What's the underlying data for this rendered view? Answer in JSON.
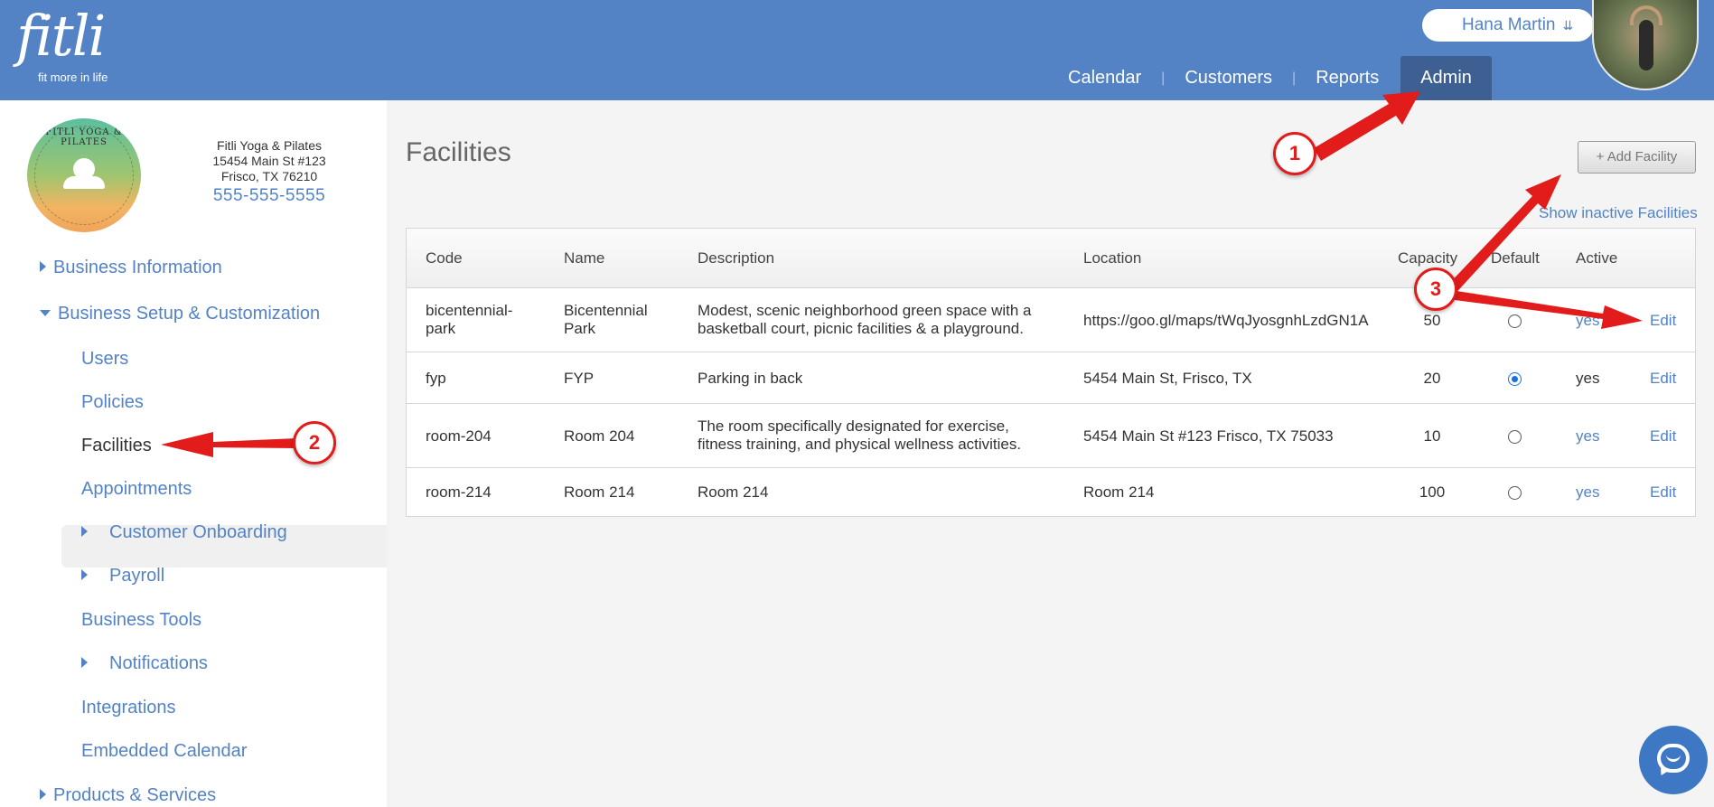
{
  "header": {
    "logo_word": "fitli",
    "logo_tagline": "fit more in life",
    "user_name": "Hana Martin",
    "nav": [
      {
        "label": "Calendar"
      },
      {
        "label": "Customers"
      },
      {
        "label": "Reports"
      },
      {
        "label": "Admin",
        "active": true
      }
    ]
  },
  "business": {
    "logo_text": "FITLI YOGA & PILATES",
    "name": "Fitli Yoga & Pilates",
    "address1": "15454 Main St #123",
    "address2": "Frisco, TX 76210",
    "phone": "555-555-5555"
  },
  "sidebar": {
    "items": [
      {
        "label": "Business Information"
      },
      {
        "label": "Business Setup & Customization"
      },
      {
        "label": "Users"
      },
      {
        "label": "Policies"
      },
      {
        "label": "Facilities",
        "active": true
      },
      {
        "label": "Appointments"
      },
      {
        "label": "Customer Onboarding"
      },
      {
        "label": "Payroll"
      },
      {
        "label": "Business Tools"
      },
      {
        "label": "Notifications"
      },
      {
        "label": "Integrations"
      },
      {
        "label": "Embedded Calendar"
      },
      {
        "label": "Products & Services"
      }
    ]
  },
  "main": {
    "title": "Facilities",
    "add_button": "+ Add Facility",
    "show_inactive": "Show inactive Facilities",
    "columns": [
      "Code",
      "Name",
      "Description",
      "Location",
      "Capacity",
      "Default",
      "Active"
    ],
    "edit_label": "Edit",
    "rows": [
      {
        "code": "bicentennial-park",
        "name": "Bicentennial Park",
        "description": "Modest, scenic neighborhood green space with a basketball court, picnic facilities & a playground.",
        "location": "https://goo.gl/maps/tWqJyosgnhLzdGN1A",
        "capacity": "50",
        "default": false,
        "active": "yes"
      },
      {
        "code": "fyp",
        "name": "FYP",
        "description": "Parking in back",
        "location": "5454 Main St, Frisco, TX",
        "capacity": "20",
        "default": true,
        "active": "yes"
      },
      {
        "code": "room-204",
        "name": "Room 204",
        "description": "The room specifically designated for exercise, fitness training, and physical wellness activities.",
        "location": "5454 Main St #123 Frisco, TX 75033",
        "capacity": "10",
        "default": false,
        "active": "yes"
      },
      {
        "code": "room-214",
        "name": "Room 214",
        "description": "Room 214",
        "location": "Room 214",
        "capacity": "100",
        "default": false,
        "active": "yes"
      }
    ]
  },
  "annotations": [
    {
      "label": "1"
    },
    {
      "label": "2"
    },
    {
      "label": "3"
    }
  ],
  "colors": {
    "header": "#5383c4",
    "nav_active": "#3d5f91",
    "link": "#5383c4",
    "annotation": "#e21b1b"
  }
}
